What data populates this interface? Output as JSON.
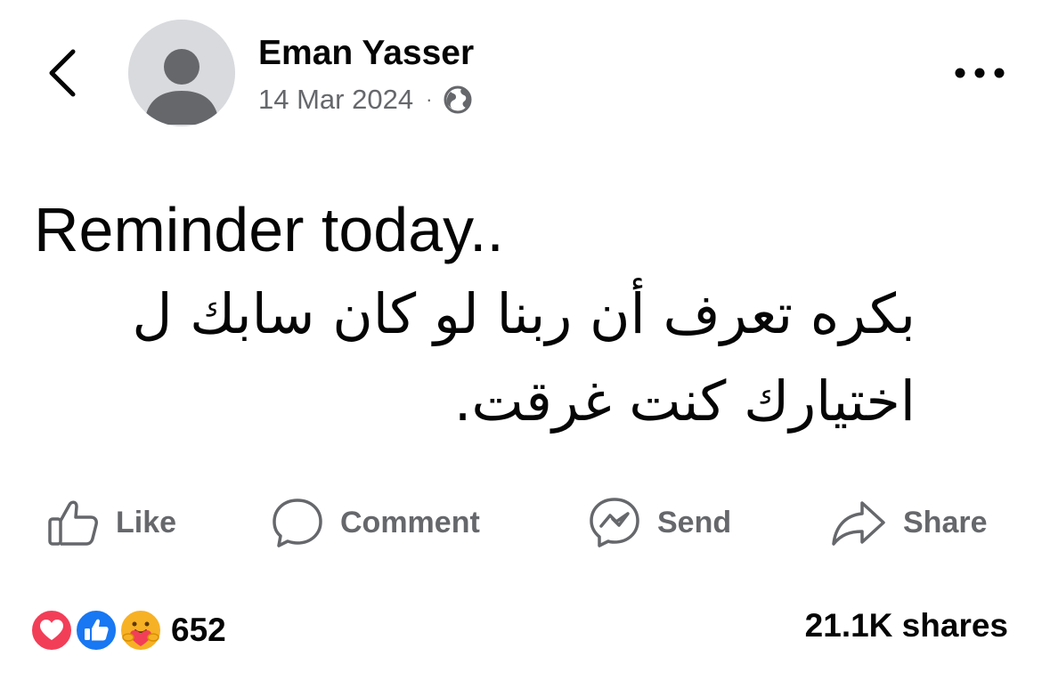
{
  "post": {
    "author": "Eman Yasser",
    "date": "14 Mar 2024",
    "separator": "·",
    "audience_icon": "globe-icon",
    "text_lines": [
      "Reminder today..",
      "بكره تعرف أن ربنا لو كان سابك ل",
      "اختيارك كنت غرقت."
    ]
  },
  "actions": {
    "like_label": "Like",
    "comment_label": "Comment",
    "send_label": "Send",
    "share_label": "Share"
  },
  "footer": {
    "reaction_count": "652",
    "reactions": [
      "love-reaction-icon",
      "like-reaction-icon",
      "care-reaction-icon"
    ],
    "shares": "21.1K shares"
  },
  "colors": {
    "text_primary": "#050505",
    "text_secondary": "#65676b",
    "like_blue": "#1877f2",
    "love_red": "#f33e58",
    "care_yellow": "#f7b125"
  }
}
